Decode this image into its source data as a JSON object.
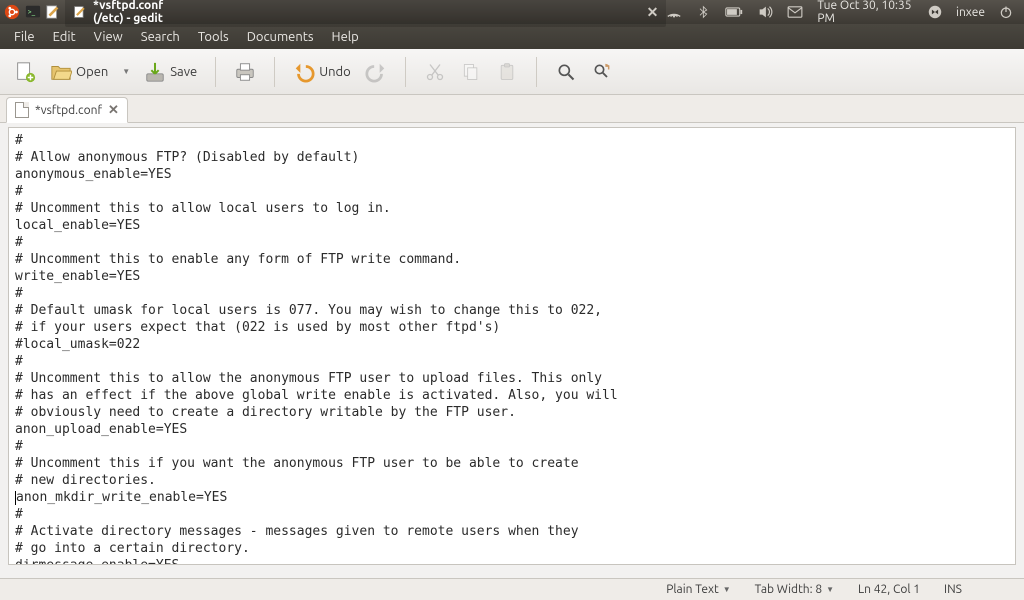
{
  "panel": {
    "window_title": "*vsftpd.conf (/etc) - gedit",
    "time": "Tue Oct 30, 10:35 PM",
    "user": "inxee"
  },
  "menubar": [
    "File",
    "Edit",
    "View",
    "Search",
    "Tools",
    "Documents",
    "Help"
  ],
  "toolbar": {
    "open_label": "Open",
    "save_label": "Save",
    "undo_label": "Undo"
  },
  "tab": {
    "filename": "*vsftpd.conf"
  },
  "editor_lines": [
    "#",
    "# Allow anonymous FTP? (Disabled by default)",
    "anonymous_enable=YES",
    "#",
    "# Uncomment this to allow local users to log in.",
    "local_enable=YES",
    "#",
    "# Uncomment this to enable any form of FTP write command.",
    "write_enable=YES",
    "#",
    "# Default umask for local users is 077. You may wish to change this to 022,",
    "# if your users expect that (022 is used by most other ftpd's)",
    "#local_umask=022",
    "#",
    "# Uncomment this to allow the anonymous FTP user to upload files. This only",
    "# has an effect if the above global write enable is activated. Also, you will",
    "# obviously need to create a directory writable by the FTP user.",
    "anon_upload_enable=YES",
    "#",
    "# Uncomment this if you want the anonymous FTP user to be able to create",
    "# new directories.",
    "anon_mkdir_write_enable=YES",
    "#",
    "# Activate directory messages - messages given to remote users when they",
    "# go into a certain directory.",
    "dirmessage_enable=YES"
  ],
  "statusbar": {
    "syntax": "Plain Text",
    "tab_width": "Tab Width: 8",
    "cursor": "Ln 42, Col 1",
    "mode": "INS"
  }
}
